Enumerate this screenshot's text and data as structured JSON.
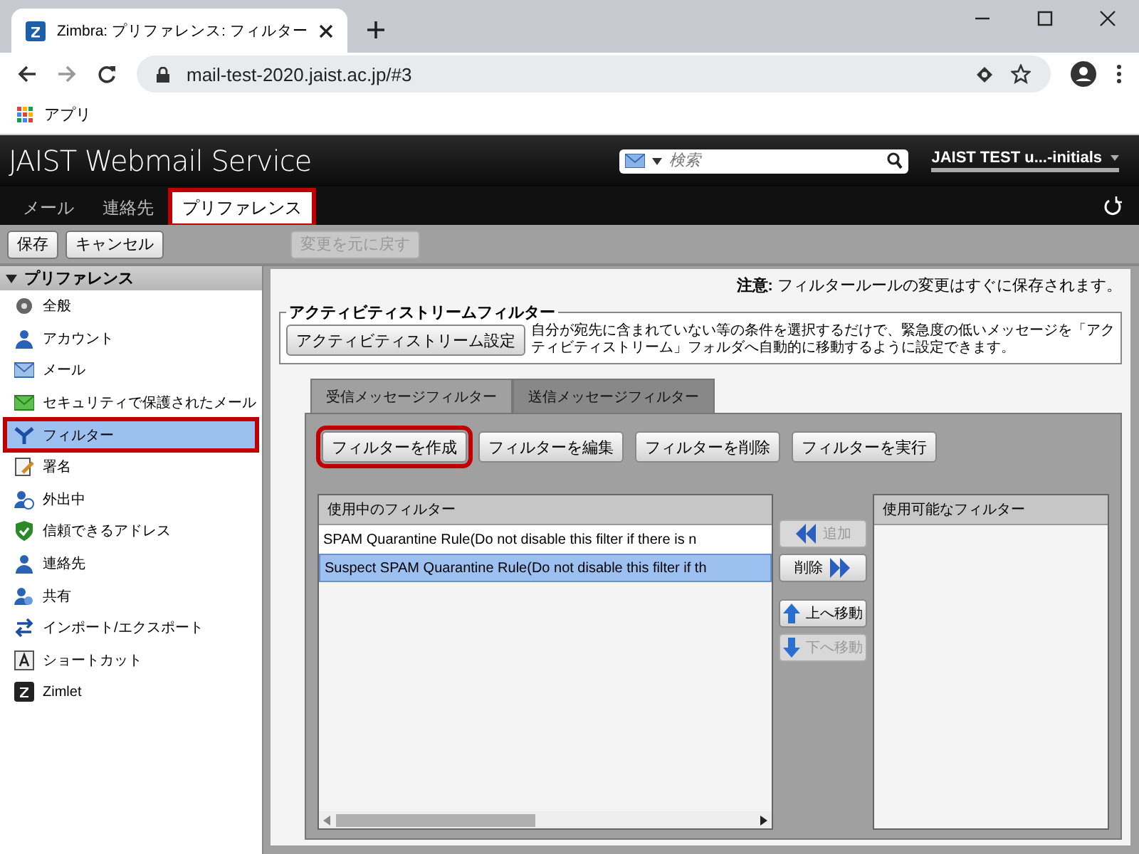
{
  "browser": {
    "tab_title": "Zimbra: プリファレンス: フィルター",
    "url": "mail-test-2020.jaist.ac.jp/#3",
    "bookmarks": [
      {
        "label": "アプリ"
      }
    ]
  },
  "app": {
    "logo": "JAIST Webmail Service",
    "search": {
      "placeholder": "検索"
    },
    "user": "JAIST TEST u...-initials"
  },
  "nav_tabs": [
    {
      "label": "メール",
      "selected": false,
      "highlighted": false
    },
    {
      "label": "連絡先",
      "selected": false,
      "highlighted": false
    },
    {
      "label": "プリファレンス",
      "selected": true,
      "highlighted": true
    }
  ],
  "toolbar": [
    {
      "label": "保存",
      "disabled": false
    },
    {
      "label": "キャンセル",
      "disabled": false
    },
    {
      "label": "変更を元に戻す",
      "disabled": true
    }
  ],
  "sidebar": {
    "title": "プリファレンス",
    "expanded": true,
    "items": [
      {
        "label": "全般",
        "selected": false,
        "highlighted": false
      },
      {
        "label": "アカウント",
        "selected": false,
        "highlighted": false
      },
      {
        "label": "メール",
        "selected": false,
        "highlighted": false
      },
      {
        "label": "セキュリティで保護されたメール",
        "selected": false,
        "highlighted": false
      },
      {
        "label": "フィルター",
        "selected": true,
        "highlighted": true
      },
      {
        "label": "署名",
        "selected": false,
        "highlighted": false
      },
      {
        "label": "外出中",
        "selected": false,
        "highlighted": false
      },
      {
        "label": "信頼できるアドレス",
        "selected": false,
        "highlighted": false
      },
      {
        "label": "連絡先",
        "selected": false,
        "highlighted": false
      },
      {
        "label": "共有",
        "selected": false,
        "highlighted": false
      },
      {
        "label": "インポート/エクスポート",
        "selected": false,
        "highlighted": false
      },
      {
        "label": "ショートカット",
        "selected": false,
        "highlighted": false
      },
      {
        "label": "Zimlet",
        "selected": false,
        "highlighted": false
      }
    ]
  },
  "notice": "**注意:** フィルタールールの変更はすぐに保存されます。",
  "activity_stream": {
    "legend": "アクティビティストリームフィルター",
    "button": "アクティビティストリーム設定",
    "description": "自分が宛先に含まれていない等の条件を選択するだけで、緊急度の低いメッセージを「アクティビティストリーム」フォルダへ自動的に移動するように設定できます。"
  },
  "filter_tabs": [
    {
      "label": "受信メッセージフィルター",
      "selected": true
    },
    {
      "label": "送信メッセージフィルター",
      "selected": false
    }
  ],
  "filter_buttons": [
    {
      "label": "フィルターを作成",
      "highlighted": true
    },
    {
      "label": "フィルターを編集",
      "highlighted": false
    },
    {
      "label": "フィルターを削除",
      "highlighted": false
    },
    {
      "label": "フィルターを実行",
      "highlighted": false
    }
  ],
  "active_filters": {
    "header": "使用中のフィルター",
    "rows": [
      {
        "label": "SPAM Quarantine Rule(Do not disable this filter if there is n",
        "selected": false
      },
      {
        "label": "Suspect SPAM Quarantine Rule(Do not disable this filter if th",
        "selected": true
      }
    ]
  },
  "available_filters": {
    "header": "使用可能なフィルター"
  },
  "move_buttons": [
    {
      "label": "追加",
      "kind": "add",
      "disabled": true
    },
    {
      "label": "削除",
      "kind": "remove",
      "disabled": false
    },
    {
      "label": "上へ移動",
      "kind": "up",
      "disabled": false
    },
    {
      "label": "下へ移動",
      "kind": "down",
      "disabled": true
    }
  ]
}
